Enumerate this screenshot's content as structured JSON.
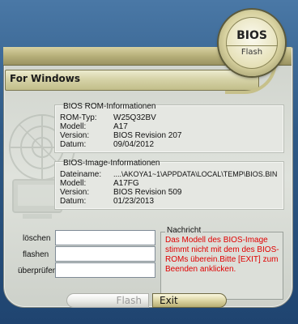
{
  "logo": {
    "title": "BIOS",
    "subtitle": "Flash"
  },
  "header": {
    "title": "For Windows"
  },
  "rom_info": {
    "title": "BIOS ROM-Informationen",
    "rows": [
      {
        "label": "ROM-Typ:",
        "value": "W25Q32BV"
      },
      {
        "label": "Modell:",
        "value": "A17"
      },
      {
        "label": "Version:",
        "value": "BIOS Revision 207"
      },
      {
        "label": "Datum:",
        "value": "09/04/2012"
      }
    ]
  },
  "image_info": {
    "title": "BIOS-Image-Informationen",
    "rows": [
      {
        "label": "Dateiname:",
        "value": "....\\AKOYA1~1\\APPDATA\\LOCAL\\TEMP\\BIOS.BIN"
      },
      {
        "label": "Modell:",
        "value": "A17FG"
      },
      {
        "label": "Version:",
        "value": "BIOS Revision 509"
      },
      {
        "label": "Datum:",
        "value": "01/23/2013"
      }
    ]
  },
  "progress": {
    "rows": [
      {
        "label": "löschen",
        "value": ""
      },
      {
        "label": "flashen",
        "value": ""
      },
      {
        "label": "überprüfen",
        "value": ""
      }
    ]
  },
  "message": {
    "title": "Nachricht",
    "text": "Das Modell des BIOS-Image stimmt nicht mit dem des BIOS-ROMs überein.Bitte [EXIT] zum Beenden anklicken.",
    "color": "#e00000"
  },
  "buttons": {
    "flash": "Flash",
    "exit": "Exit"
  },
  "colors": {
    "accent_gold": "#c6c08a",
    "window_bg": "#dfe2dc",
    "desktop_bg": "#2f5a86"
  }
}
